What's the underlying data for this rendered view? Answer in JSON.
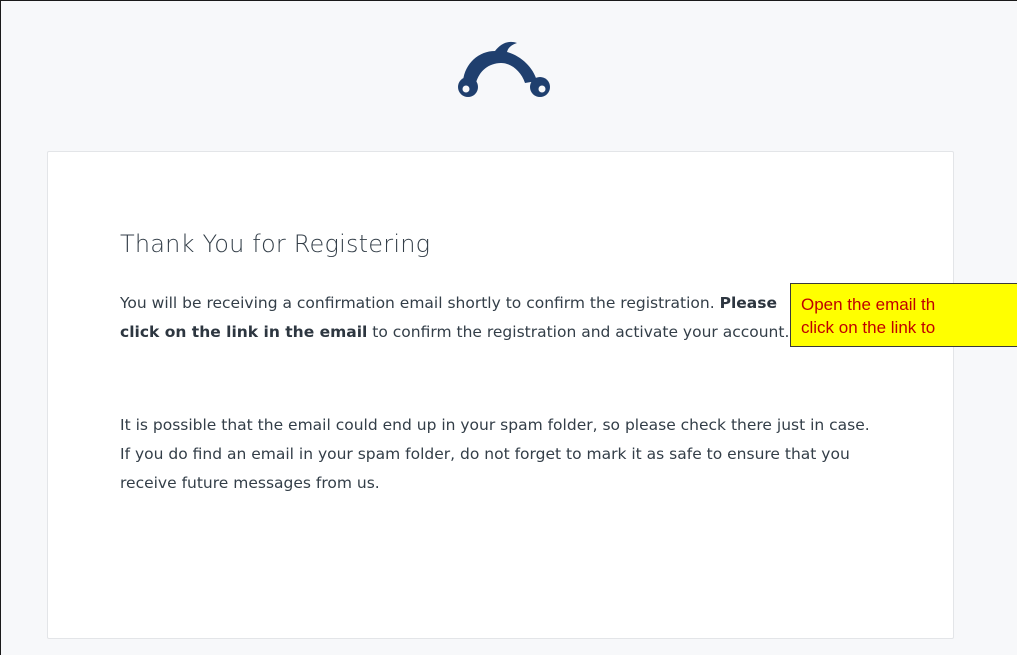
{
  "logo": {
    "icon": "surveymonkey-logo-icon",
    "color": "#1f3f6e"
  },
  "card": {
    "title": "Thank You for Registering",
    "paragraph1": {
      "before": "You will be receiving a confirmation email shortly to confirm the registration. ",
      "bold": "Please click on the link in the email",
      "after": " to confirm the registration and activate your account."
    },
    "paragraph2": "It is possible that the email could end up in your spam folder, so please check there just in case. If you do find an email in your spam folder, do not forget to mark it as safe to ensure that you receive future messages from us."
  },
  "callout": {
    "text": "Open the email th\nclick on the link to",
    "background": "#ffff00",
    "text_color": "#c00000"
  }
}
